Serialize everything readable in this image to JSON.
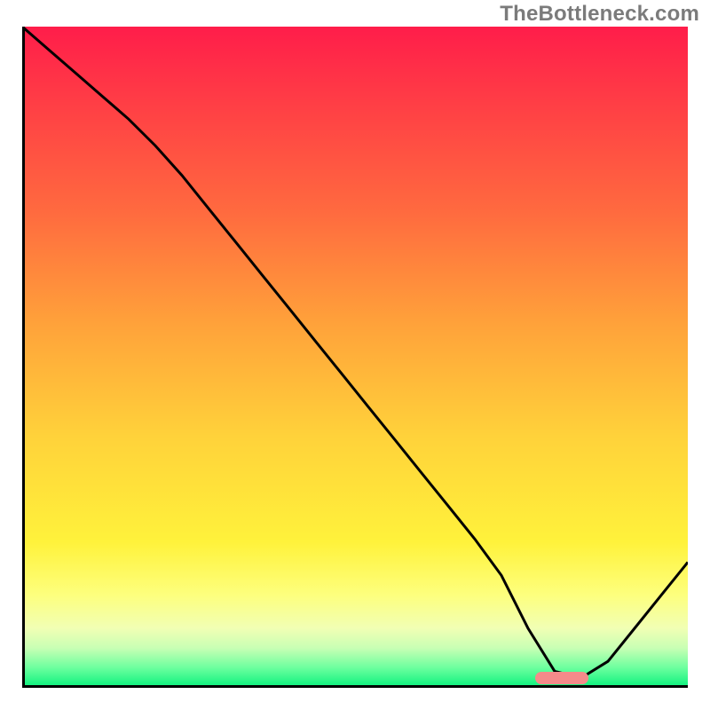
{
  "watermark": "TheBottleneck.com",
  "chart_data": {
    "type": "line",
    "title": "",
    "xlabel": "",
    "ylabel": "",
    "xlim": [
      0,
      100
    ],
    "ylim": [
      0,
      100
    ],
    "x": [
      0,
      4,
      8,
      12,
      16,
      20,
      24,
      28,
      32,
      36,
      40,
      44,
      48,
      52,
      56,
      60,
      64,
      68,
      72,
      76,
      80,
      84,
      88,
      92,
      96,
      100
    ],
    "values": [
      100,
      96.5,
      93,
      89.5,
      86,
      82,
      77.5,
      72.5,
      67.5,
      62.5,
      57.5,
      52.5,
      47.5,
      42.5,
      37.5,
      32.5,
      27.5,
      22.5,
      17,
      9,
      2.5,
      1.5,
      4,
      9,
      14,
      19
    ],
    "grid": false,
    "legend": false
  },
  "marker": {
    "x_start": 77,
    "x_end": 85,
    "y": 1.5,
    "color": "#f58a8a"
  },
  "colors": {
    "line": "#000000",
    "axis": "#000000",
    "marker": "#f58a8a",
    "gradient_top": "#ff1d4a",
    "gradient_bottom": "#08f07c"
  }
}
